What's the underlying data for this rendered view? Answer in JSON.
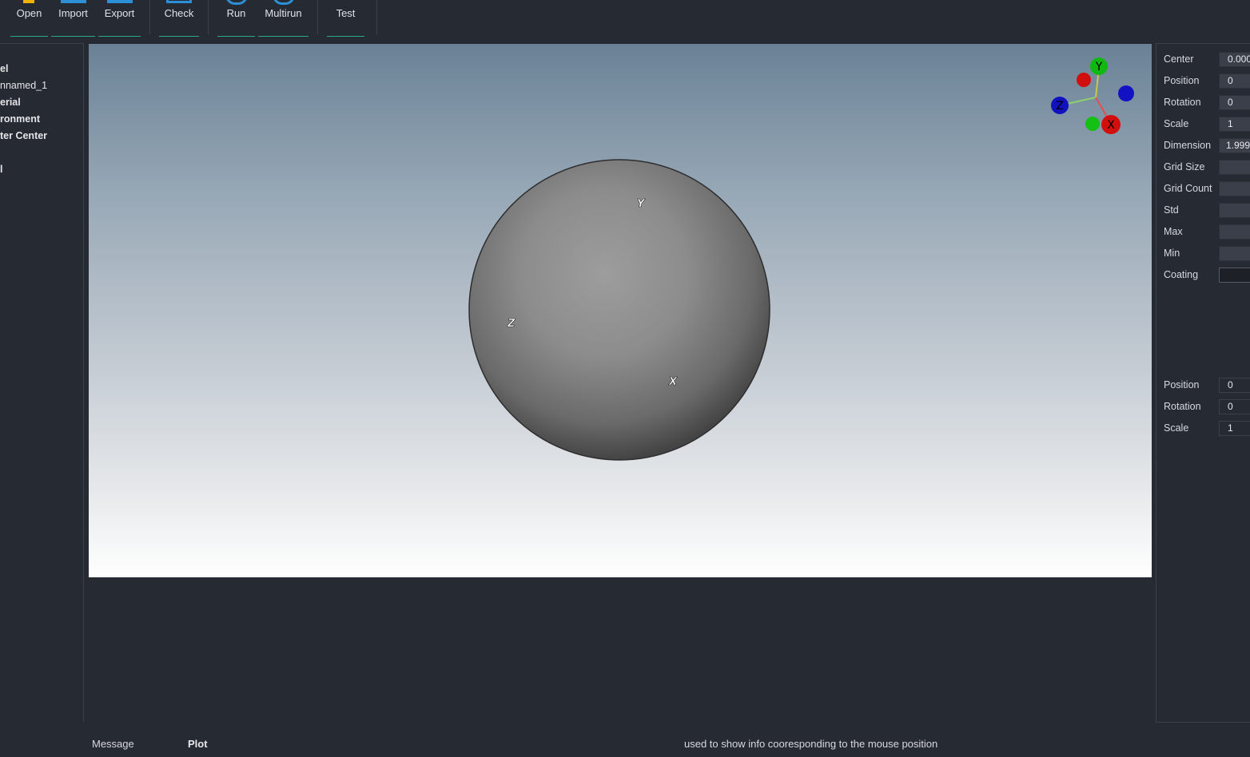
{
  "toolbar": {
    "open": "Open",
    "import": "Import",
    "export": "Export",
    "check": "Check",
    "run": "Run",
    "multirun": "Multirun",
    "test": "Test"
  },
  "tree": {
    "model": "el",
    "unnamed": "nnamed_1",
    "material": "erial",
    "environment": "ronment",
    "center": "ter Center",
    "extra": "l"
  },
  "viewport": {
    "sphere_labels": {
      "x": "X",
      "y": "Y",
      "z": "Z"
    },
    "gizmo": {
      "x": "X",
      "y": "Y",
      "z": "Z"
    }
  },
  "properties": {
    "center_label": "Center",
    "center_value": "0.000",
    "position_label": "Position",
    "position_value": "0",
    "rotation_label": "Rotation",
    "rotation_value": "0",
    "scale_label": "Scale",
    "scale_value": "1",
    "dimension_label": "Dimension",
    "dimension_value": "1.999",
    "grid_size_label": "Grid Size",
    "grid_size_value": "",
    "grid_count_label": "Grid Count",
    "grid_count_value": "",
    "std_label": "Std",
    "std_value": "",
    "max_label": "Max",
    "max_value": "",
    "min_label": "Min",
    "min_value": "",
    "coating_label": "Coating",
    "coating_value": ""
  },
  "transform": {
    "position_label": "Position",
    "position_value": "0",
    "rotation_label": "Rotation",
    "rotation_value": "0",
    "scale_label": "Scale",
    "scale_value": "1"
  },
  "status": {
    "message_tab": "Message",
    "plot_tab": "Plot",
    "info": "used to show info cooresponding to the mouse position"
  },
  "colors": {
    "accent": "#2aa889",
    "axis_x": "#d11a1a",
    "axis_y": "#13b313",
    "axis_z": "#1515c8"
  }
}
